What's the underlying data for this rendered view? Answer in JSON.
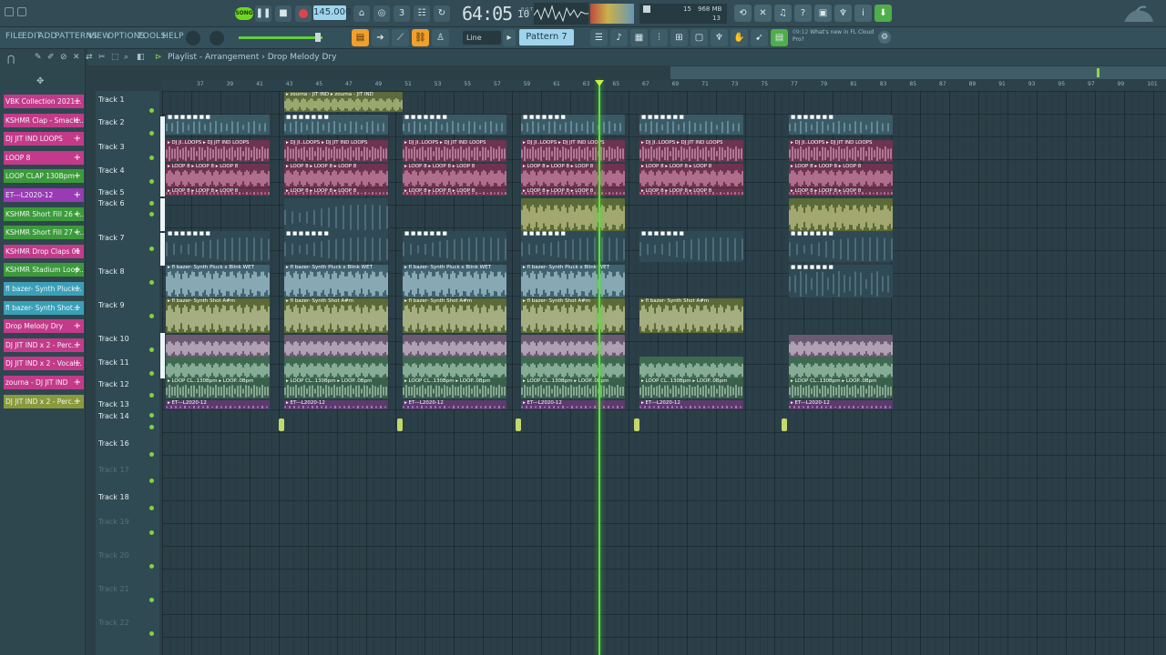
{
  "transport": {
    "song_mode": "SONG",
    "tempo": "145.000",
    "time": "64:05",
    "time_ticks": "10",
    "time_sub": "B:S:T",
    "cpu_voices": "15",
    "memory": "968 MB",
    "memory_sub": "13"
  },
  "menu": {
    "items": [
      "FILE",
      "EDIT",
      "ADD",
      "PATTERNS",
      "VIEW",
      "OPTIONS",
      "TOOLS",
      "HELP"
    ]
  },
  "toolbar": {
    "snap_mode": "Line",
    "pattern": "Pattern 7",
    "news_id": "09:12",
    "news_text": "What's new in FL Cloud Pro?"
  },
  "playlist": {
    "title": "Playlist - Arrangement",
    "separator": "›",
    "current_pattern": "Drop Melody Dry",
    "ruler": [
      "37",
      "39",
      "41",
      "43",
      "45",
      "47",
      "49",
      "51",
      "53",
      "55",
      "57",
      "59",
      "61",
      "63",
      "65",
      "67",
      "69",
      "71",
      "73",
      "75",
      "77",
      "79",
      "81",
      "83",
      "85",
      "87",
      "89",
      "91",
      "93",
      "95",
      "97",
      "99",
      "101"
    ],
    "tracks": [
      "Track 1",
      "Track 2",
      "Track 3",
      "Track 4",
      "Track 5",
      "Track 6",
      "Track 7",
      "Track 8",
      "Track 9",
      "Track 10",
      "Track 11",
      "Track 12",
      "Track 13",
      "Track 14",
      "Track 16",
      "Track 17",
      "Track 18",
      "Track 19",
      "Track 20",
      "Track 21",
      "Track 22"
    ]
  },
  "channels": [
    {
      "name": "VBK Collection 2021...",
      "color": "#c43a8a"
    },
    {
      "name": "KSHMR Clap - Smack...",
      "color": "#c43a8a"
    },
    {
      "name": "DJ JIT IND LOOPS",
      "color": "#c43a8a"
    },
    {
      "name": "LOOP 8",
      "color": "#c43a8a"
    },
    {
      "name": "LOOP CLAP 130Bpm",
      "color": "#3d9a3a"
    },
    {
      "name": "ET---L2020-12",
      "color": "#9a3ab4"
    },
    {
      "name": "KSHMR Short Fill 26 -...",
      "color": "#3d9a3a"
    },
    {
      "name": "KSHMR Short Fill 27 -...",
      "color": "#3d9a3a"
    },
    {
      "name": "KSHMR Drop Claps 01",
      "color": "#c43a8a"
    },
    {
      "name": "KSHMR Stadium Loop...",
      "color": "#3d9a3a"
    },
    {
      "name": "fl bazer- Synth Pluck...",
      "color": "#3aa0b8"
    },
    {
      "name": "fl bazer- Synth Shot...",
      "color": "#3aa0b8"
    },
    {
      "name": "Drop Melody Dry",
      "color": "#c43a8a"
    },
    {
      "name": "DJ JIT IND x 2 - Perc...",
      "color": "#c43a8a"
    },
    {
      "name": "DJ JIT IND x 2 - Vocal...",
      "color": "#c43a8a"
    },
    {
      "name": "zourna - DJ JIT IND",
      "color": "#c43a8a"
    },
    {
      "name": "DJ JIT IND x 2 - Perc...",
      "color": "#8a9a3a"
    }
  ],
  "clip_labels": {
    "zourna": "▸ zourna - JIT IND ▸ zourna - JIT IND",
    "djloops": "▸ DJ JI..LOOPS ▸ DJ JIT IND LOOPS",
    "loop8": "▸ LOOP 8 ▸ LOOP 8 ▸ LOOP 8",
    "pluck": "▸ fl bazer- Synth Pluck x Blink WET",
    "shot": "▸ fl bazer- Synth Shot A#m",
    "loopclap": "▸ LOOP CL..130Bpm ▸ LOOP..0Bpm",
    "et": "▸ ET---L2020-12"
  }
}
